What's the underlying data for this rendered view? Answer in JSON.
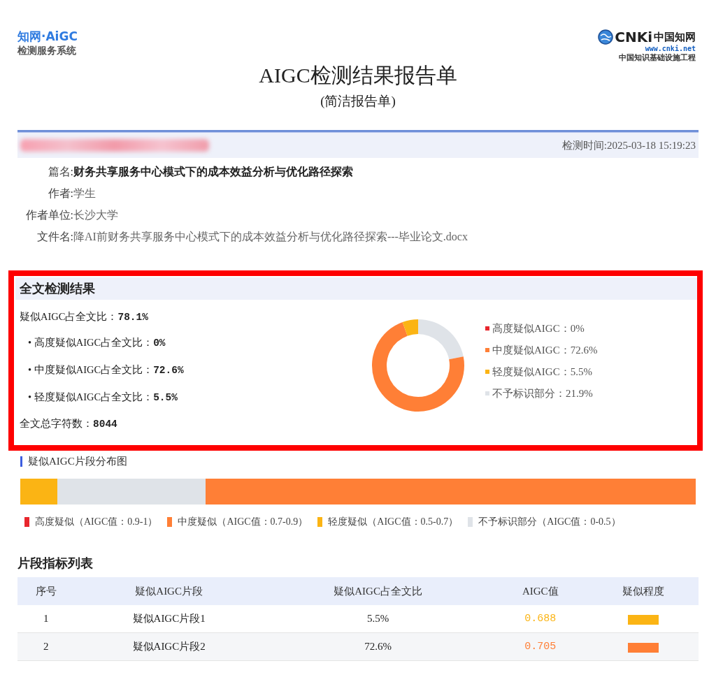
{
  "header": {
    "logo_text": "知网·AiGC",
    "logo_subtitle": "检测服务系统",
    "brand_mark": "CNKi",
    "brand_name": "中国知网",
    "brand_url": "www.cnki.net",
    "brand_tagline": "中国知识基础设施工程",
    "title": "AIGC检测结果报告单",
    "subtitle": "(简洁报告单)"
  },
  "info_bar": {
    "detection_time": "检测时间:2025-03-18 15:19:23"
  },
  "meta": [
    {
      "label": "篇名:",
      "value": "财务共享服务中心模式下的成本效益分析与优化路径探索",
      "emphasis": true
    },
    {
      "label": "作者:",
      "value": "学生",
      "emphasis": false
    },
    {
      "label": "作者单位:",
      "value": "长沙大学",
      "emphasis": false
    },
    {
      "label": "文件名:",
      "value": "降AI前财务共享服务中心模式下的成本效益分析与优化路径探索---毕业论文.docx",
      "emphasis": false
    }
  ],
  "result": {
    "highlighted": true,
    "title": "全文检测结果",
    "stats": [
      {
        "kind": "total",
        "text": "疑似AIGC占全文比：**78.1%**"
      },
      {
        "kind": "sub",
        "text": "• 高度疑似AIGC占全文比：**0%**"
      },
      {
        "kind": "sub",
        "text": "• 中度疑似AIGC占全文比：**72.6%**"
      },
      {
        "kind": "sub",
        "text": "• 轻度疑似AIGC占全文比：**5.5%**"
      },
      {
        "kind": "total",
        "text": "全文总字符数：**8044**"
      }
    ],
    "chart_data": {
      "type": "donut",
      "categories": [
        "高度疑似AIGC：0%",
        "中度疑似AIGC：72.6%",
        "轻度疑似AIGC：5.5%",
        "不予标识部分：21.9%"
      ],
      "series": [
        {
          "values": [
            0,
            72.6,
            5.5,
            21.9
          ]
        }
      ]
    },
    "legend": [
      {
        "color": "#e8262d"
      },
      {
        "color": "#ff7f36"
      },
      {
        "color": "#fbb414"
      },
      {
        "color": "#dfe3e8"
      }
    ]
  },
  "distribution": {
    "title": "疑似AIGC片段分布图",
    "legend": [
      {
        "label": "高度疑似（AIGC值：0.9-1）",
        "color": "#e8262d"
      },
      {
        "label": "中度疑似（AIGC值：0.7-0.9）",
        "color": "#ff7f36"
      },
      {
        "label": "轻度疑似（AIGC值：0.5-0.7）",
        "color": "#fbb414"
      },
      {
        "label": "不予标识部分（AIGC值：0-0.5）",
        "color": "#dfe3e8"
      }
    ]
  },
  "segment_table": {
    "title": "片段指标列表",
    "columns": [
      "序号",
      "疑似AIGC片段",
      "疑似AIGC占全文比",
      "AIGC值",
      "疑似程度"
    ],
    "rows": [
      {
        "cells": [
          "1",
          "疑似AIGC片段1",
          "5.5%",
          "0.688"
        ],
        "color": "#fbb414"
      },
      {
        "cells": [
          "2",
          "疑似AIGC片段2",
          "72.6%",
          "0.705"
        ],
        "color": "#ff7f36"
      }
    ]
  }
}
